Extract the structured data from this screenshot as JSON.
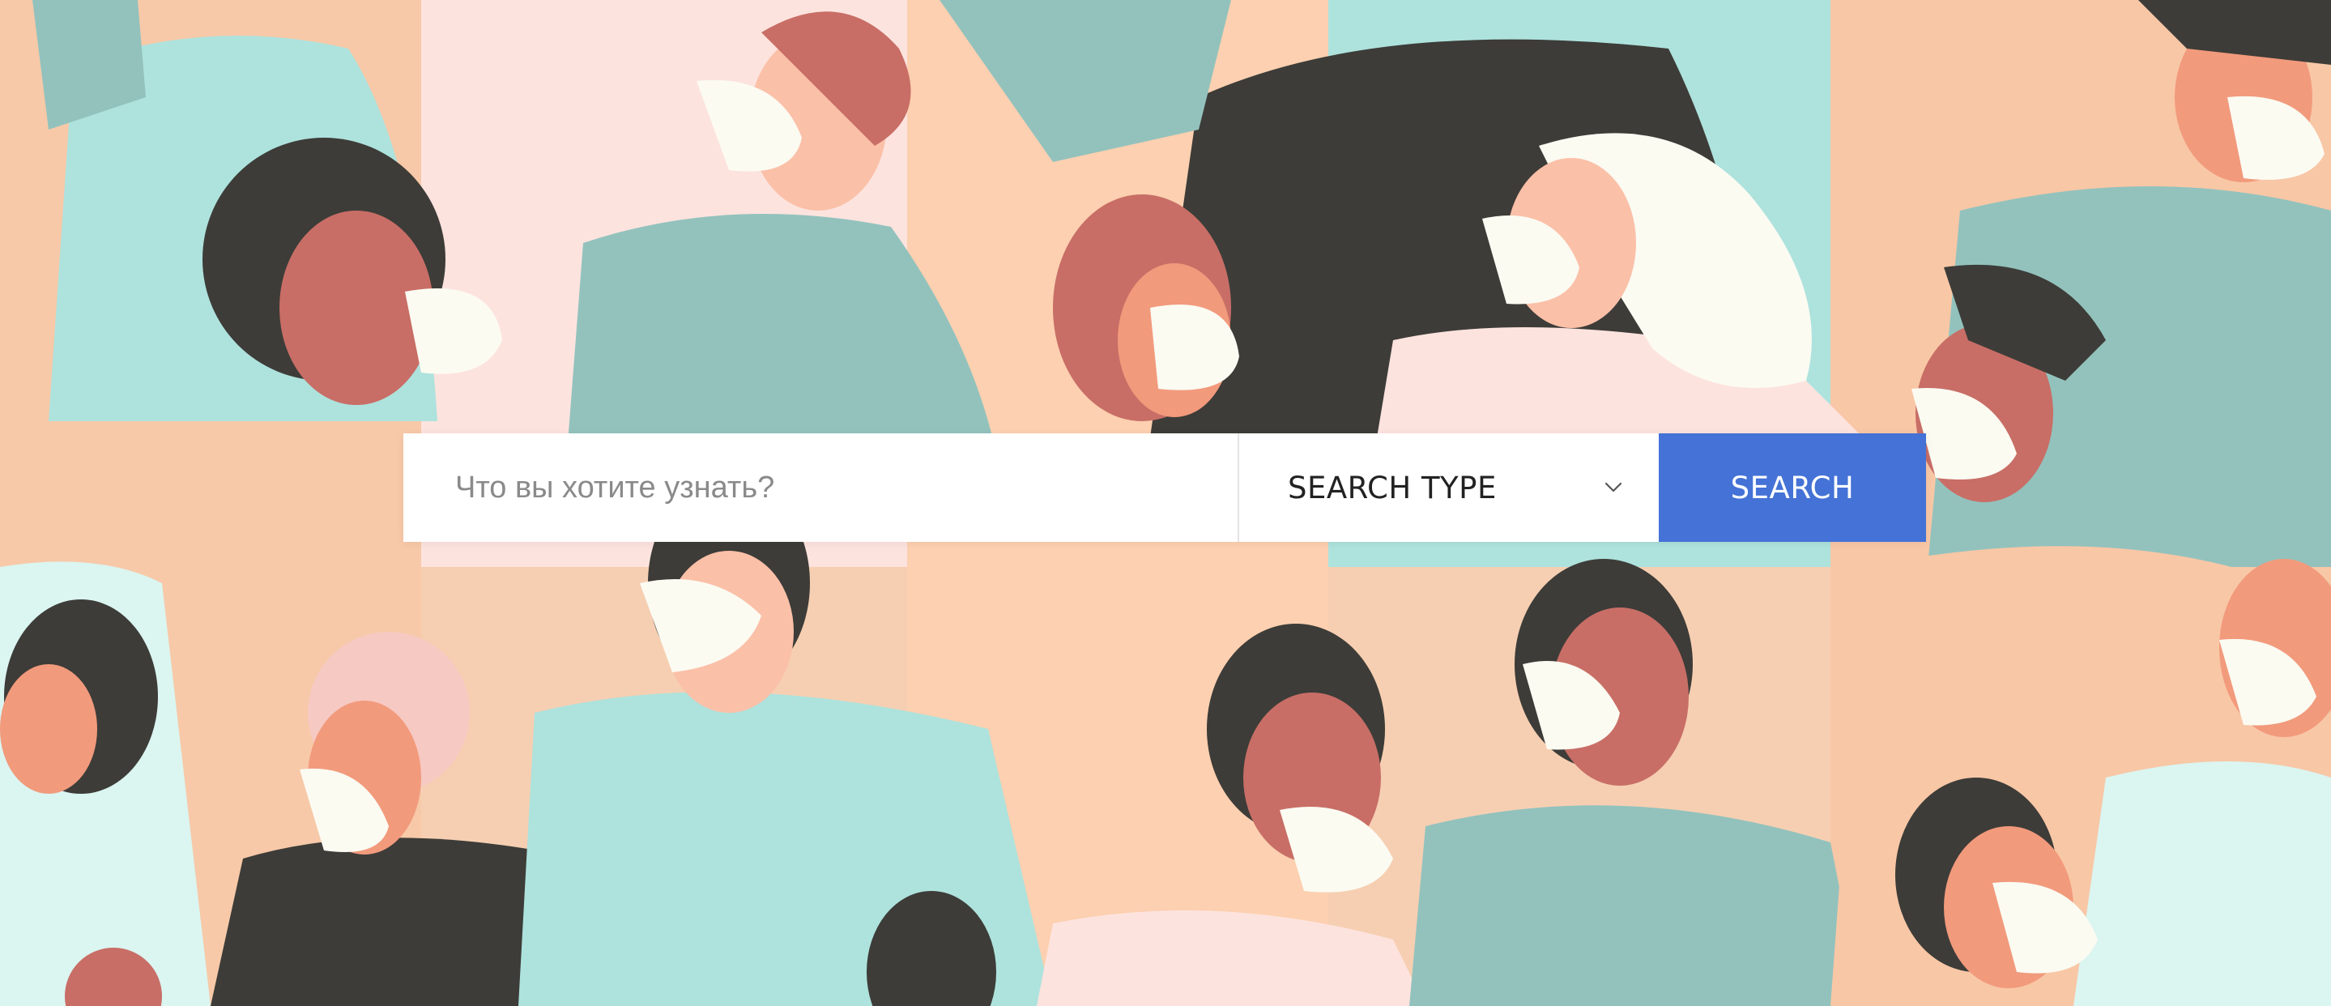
{
  "colors": {
    "accent": "#4472d6",
    "input_background": "#ffffff",
    "placeholder_text": "#8a8a8a",
    "label_text": "#222222",
    "button_text": "#ffffff"
  },
  "search": {
    "placeholder": "Что вы хотите узнать?",
    "value": ""
  },
  "search_type": {
    "label": "SEARCH TYPE",
    "icon": "chevron-down-icon"
  },
  "search_button": {
    "label": "SEARCH"
  },
  "hero": {
    "illustration": "crowd-of-people-wearing-face-masks"
  }
}
